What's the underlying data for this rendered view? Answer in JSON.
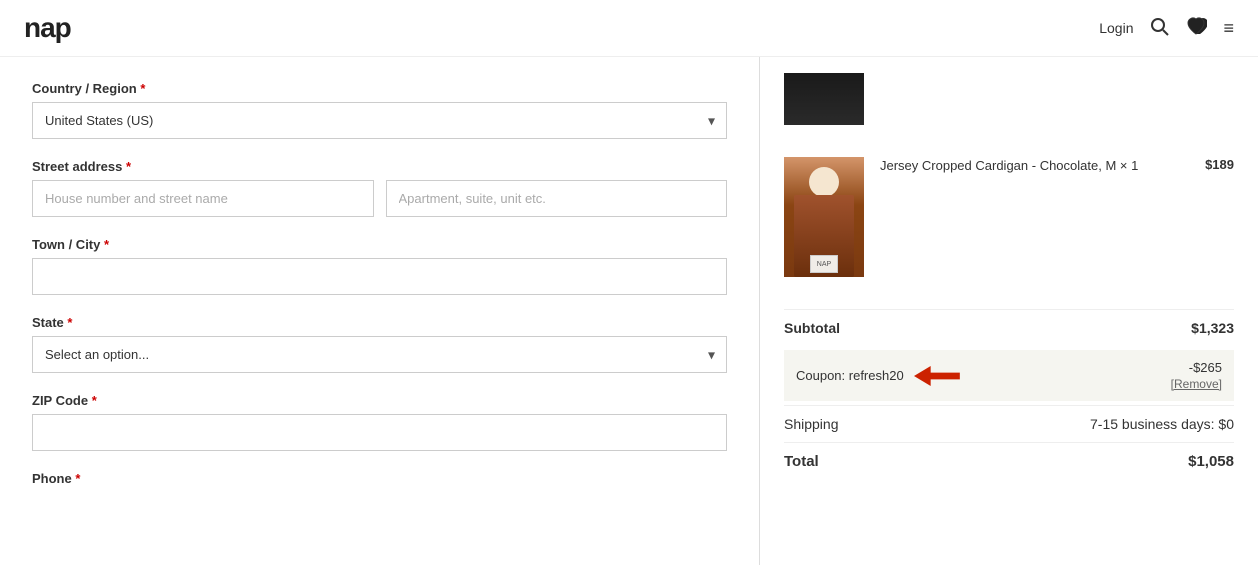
{
  "header": {
    "logo": "nap",
    "nav": {
      "login": "Login"
    }
  },
  "form": {
    "country_label": "Country / Region",
    "country_required": true,
    "country_value": "United States (US)",
    "street_label": "Street address",
    "street_required": true,
    "street_placeholder1": "House number and street name",
    "street_placeholder2": "Apartment, suite, unit etc.",
    "city_label": "Town / City",
    "city_required": true,
    "city_value": "",
    "state_label": "State",
    "state_required": true,
    "state_placeholder": "Select an option...",
    "zip_label": "ZIP Code",
    "zip_required": true,
    "zip_value": "",
    "phone_label": "Phone"
  },
  "order": {
    "subtotal_label": "Subtotal",
    "subtotal_value": "$1,323",
    "coupon_label": "Coupon: refresh20",
    "coupon_discount": "-$265",
    "coupon_remove": "[Remove]",
    "shipping_label": "Shipping",
    "shipping_value": "7-15 business days: $0",
    "total_label": "Total",
    "total_value": "$1,058",
    "products": [
      {
        "name": "Jersey Cropped Cardigan - Chocolate, M × 1",
        "price": "$189",
        "image_type": "cardigan"
      }
    ]
  }
}
